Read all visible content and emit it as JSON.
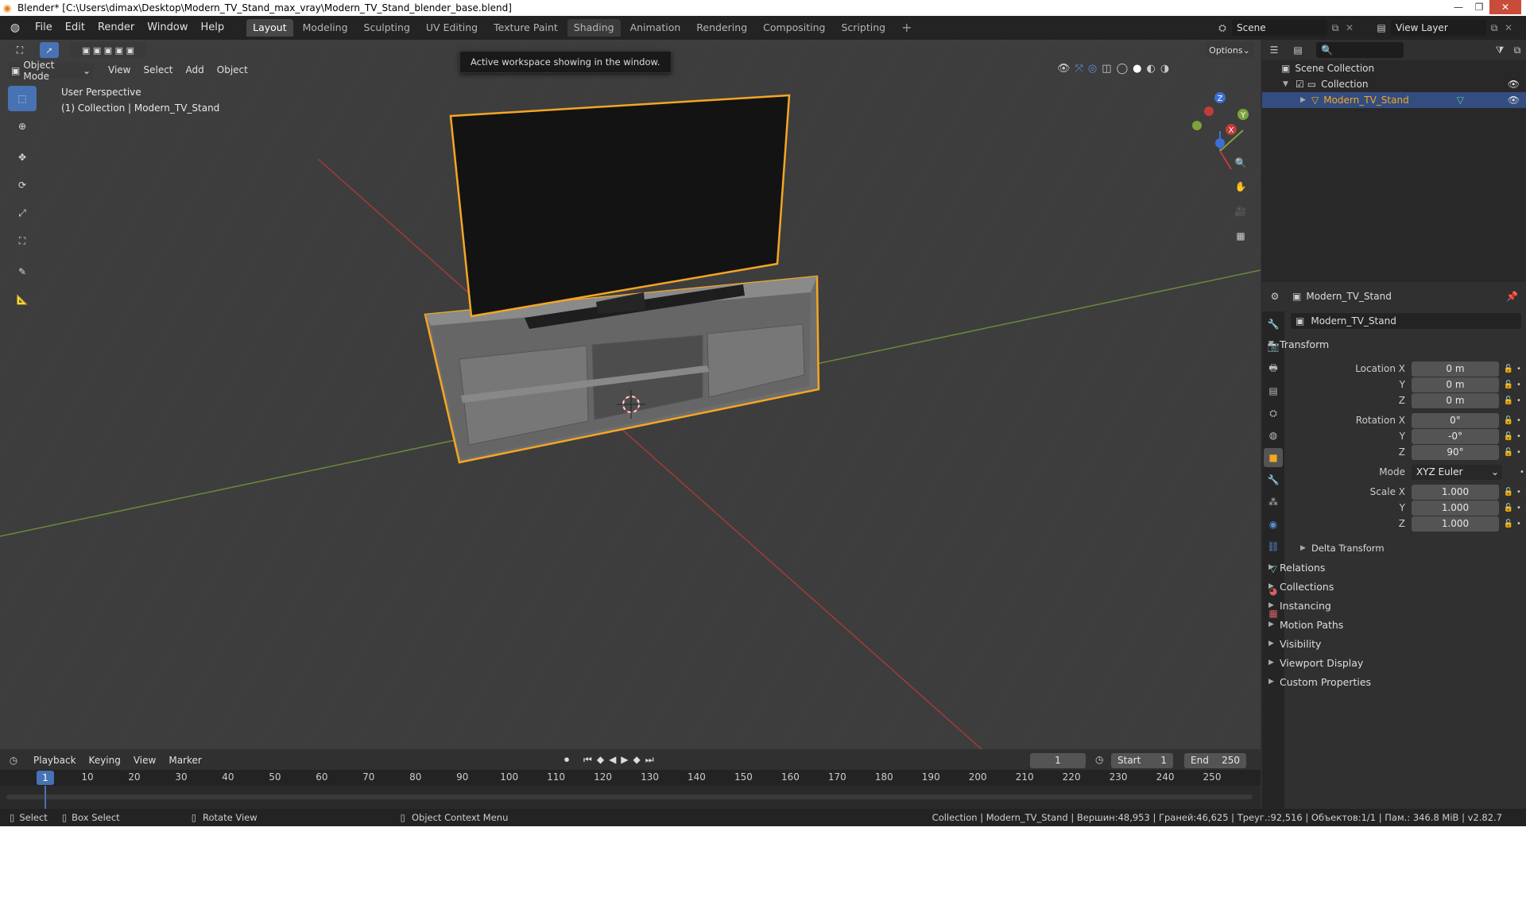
{
  "window": {
    "title": "Blender* [C:\\Users\\dimax\\Desktop\\Modern_TV_Stand_max_vray\\Modern_TV_Stand_blender_base.blend]"
  },
  "topbar": {
    "menus": [
      "File",
      "Edit",
      "Render",
      "Window",
      "Help"
    ],
    "workspaces": [
      "Layout",
      "Modeling",
      "Sculpting",
      "UV Editing",
      "Texture Paint",
      "Shading",
      "Animation",
      "Rendering",
      "Compositing",
      "Scripting"
    ],
    "active_workspace": "Layout",
    "add_tab": "+",
    "scene": "Scene",
    "view_layer": "View Layer"
  },
  "viewport": {
    "mode": "Object Mode",
    "menus": [
      "View",
      "Select",
      "Add",
      "Object"
    ],
    "options_label": "Options",
    "tooltip": "Active workspace showing in the window.",
    "perspective_label": "User Perspective",
    "collection_label": "(1) Collection | Modern_TV_Stand",
    "gizmo_axes": {
      "x": "X",
      "y": "Y",
      "z": "Z"
    }
  },
  "outliner": {
    "scene_collection": "Scene Collection",
    "collection": "Collection",
    "object": "Modern_TV_Stand"
  },
  "properties": {
    "object_name": "Modern_TV_Stand",
    "data_name": "Modern_TV_Stand",
    "transform_label": "Transform",
    "location_label": "Location X",
    "y_label": "Y",
    "z_label": "Z",
    "location": {
      "x": "0 m",
      "y": "0 m",
      "z": "0 m"
    },
    "rotation_label": "Rotation X",
    "rotation": {
      "x": "0°",
      "y": "-0°",
      "z": "90°"
    },
    "mode_label": "Mode",
    "mode_value": "XYZ Euler",
    "scale_label": "Scale X",
    "scale": {
      "x": "1.000",
      "y": "1.000",
      "z": "1.000"
    },
    "delta_transform": "Delta Transform",
    "sections": [
      "Relations",
      "Collections",
      "Instancing",
      "Motion Paths",
      "Visibility",
      "Viewport Display",
      "Custom Properties"
    ]
  },
  "timeline": {
    "menus": [
      "Playback",
      "Keying",
      "View",
      "Marker"
    ],
    "current_frame": "1",
    "start_label": "Start",
    "start_value": "1",
    "end_label": "End",
    "end_value": "250",
    "ticks": [
      "10",
      "20",
      "30",
      "40",
      "50",
      "60",
      "70",
      "80",
      "90",
      "100",
      "110",
      "120",
      "130",
      "140",
      "150",
      "160",
      "170",
      "180",
      "190",
      "200",
      "210",
      "220",
      "230",
      "240",
      "250"
    ]
  },
  "statusbar": {
    "select": "Select",
    "box_select": "Box Select",
    "rotate_view": "Rotate View",
    "context_menu": "Object Context Menu",
    "stats": "Collection | Modern_TV_Stand | Вершин:48,953 | Граней:46,625 | Треуг.:92,516 | Объектов:1/1 | Пам.: 346.8 MiB | v2.82.7"
  },
  "colors": {
    "accent": "#4772b3",
    "selection_outline": "#f5a623",
    "x_axis": "#c23b3b",
    "y_axis": "#7da33a",
    "z_axis": "#3b6fd4",
    "viewport_bg": "#3d3d3d"
  }
}
